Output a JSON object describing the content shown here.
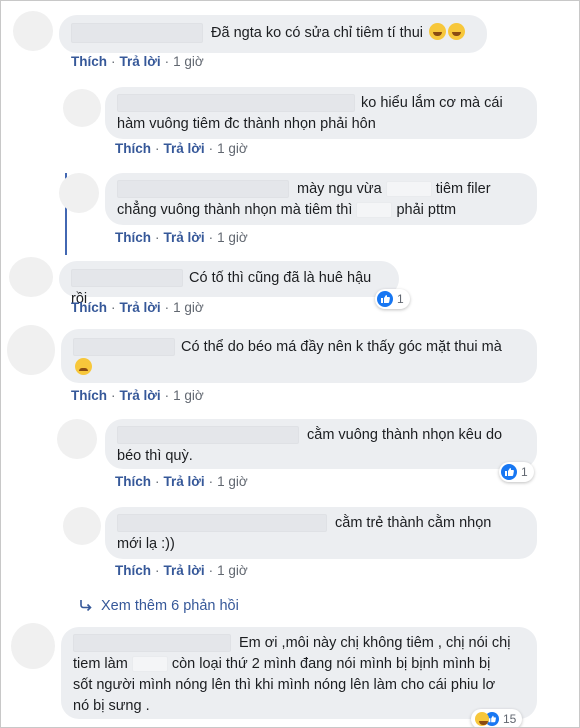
{
  "actions": {
    "like": "Thích",
    "reply": "Trả lời",
    "sep": "·"
  },
  "comments": [
    {
      "text": "Đã ngta ko có sửa chỉ tiêm tí thui",
      "time": "1 giờ"
    },
    {
      "line1": "ko hiểu lắm cơ mà cái",
      "line2": "hàm vuông tiêm đc thành nhọn phải hôn",
      "time": "1 giờ"
    },
    {
      "line1a": "mày ngu vừa",
      "line1b": "tiêm filer",
      "line2a": "chẳng vuông thành nhọn mà tiêm thì",
      "line2b": "phải pttm",
      "time": "1 giờ"
    },
    {
      "text": "Có tố thì cũng đã là huê hậu rồi",
      "time": "1 giờ",
      "reactions": "1"
    },
    {
      "text": "Có thể do béo má đầy nên k thấy góc mặt thui mà",
      "time": "1 giờ"
    },
    {
      "line1": "cằm vuông thành nhọn kêu do",
      "line2": "béo thì quỳ.",
      "time": "1 giờ",
      "reactions": "1"
    },
    {
      "line1": "cằm trẻ thành cằm nhọn",
      "line2": "mới lạ :))",
      "time": "1 giờ"
    },
    {
      "line1": "Em ơi ,môi này chị không tiêm , chị nói chị",
      "line2a": "tiem làm",
      "line2b": "còn loại thứ 2 mình đang nói mình bị bịnh mình bị",
      "line3": "sốt người mình nóng lên thì khi mình nóng lên làm cho cái phiu lơ",
      "line4": "nó bị sưng .",
      "reactions": "15"
    }
  ],
  "see_more": "Xem thêm 6 phản hồi"
}
